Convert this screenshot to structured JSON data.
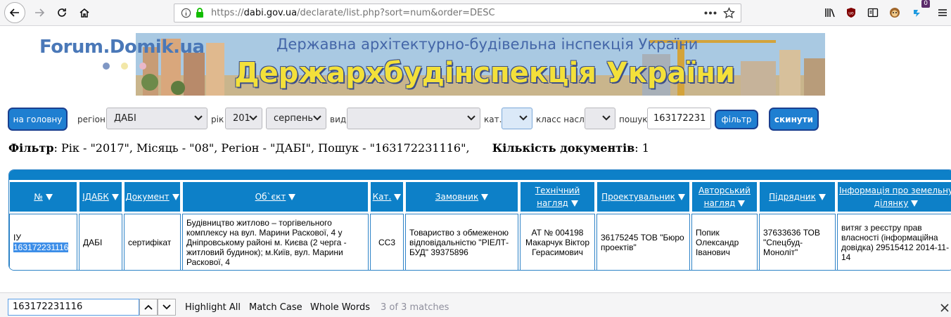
{
  "browser": {
    "url_prefix": "https://",
    "url_host": "dabi.gov.ua",
    "url_path": "/declarate/list.php?sort=num&order=DESC",
    "extension_badge": "0",
    "icons": [
      "back-icon",
      "forward-icon",
      "reload-icon",
      "home-icon",
      "info-icon",
      "lock-icon",
      "more-icon",
      "bookmark-star-icon",
      "library-icon",
      "ublock-icon",
      "reader-icon",
      "monkey-icon",
      "extension-icon",
      "menu-icon"
    ]
  },
  "header": {
    "forum_logo": "Forum.Domik.ua",
    "banner_subtitle": "Державна архітектурно-будівельна інспекція України",
    "banner_title": "Держархбудінспекція України"
  },
  "filters": {
    "home_button": "на головну",
    "region_label": "регіон",
    "region_value": "ДАБІ",
    "year_label": "рік",
    "year_value": "201",
    "month_value": "серпень",
    "type_label": "вид",
    "type_value": "",
    "cat_label": "кат.",
    "cat_value": "",
    "class_label": "класс насл.",
    "class_value": "",
    "search_label": "пошук",
    "search_value": "163172231",
    "filter_button": "фільтр",
    "reset_button": "скинути"
  },
  "summary": {
    "filter_word": "Фільтр",
    "filter_text": ": Рік - \"2017\", Місяць - \"08\", Регіон - \"ДАБІ\", Пошук - \"163172231116\",",
    "count_label": "Кількість документів",
    "count_value": ": 1"
  },
  "table": {
    "headers": {
      "num": "№",
      "idabk": "IДАБК",
      "doc": "Документ",
      "object": "Об`єкт",
      "cat": "Кат.",
      "customer": "Замовник",
      "tech_1": "Технічний",
      "tech_2": "нагляд",
      "designer": "Проектувальник",
      "author_1": "Авторський",
      "author_2": "нагляд",
      "contractor": "Підрядник",
      "land_1": "Інформація про земельну",
      "land_2": "ділянку"
    },
    "row": {
      "num_prefix": "ІУ",
      "num_highlight": "163172231116",
      "idabk": "ДАБІ",
      "doc": "сертифікат",
      "object": "Будівництво житлово – торгівельного комплексу на вул. Марини Раскової, 4 у Дніпровському районі м. Києва (2 черга - житловий будинок); м.Київ, вул. Марини Раскової, 4",
      "cat": "СС3",
      "customer": "Товариство з обмеженою відповідальністю \"РІЕЛТ-БУД\" 39375896",
      "tech": "АТ № 004198 Макарчук Віктор Герасимович",
      "designer": "36175245 ТОВ \"Бюро проектів\"",
      "author": "Попик Олександр Іванович",
      "contractor": "37633636 ТОВ \"Спецбуд-Моноліт\"",
      "land": "витяг з реєстру прав власності (інформаційна довідка) 29515412 2014-11-14"
    }
  },
  "findbar": {
    "query": "163172231116",
    "highlight_all": "Highlight All",
    "match_case": "Match Case",
    "whole_words": "Whole Words",
    "status": "3 of 3 matches"
  },
  "colors": {
    "accent_blue": "#0d80c8",
    "button_blue": "#1f7fd1",
    "highlight": "#3d8ee8"
  }
}
